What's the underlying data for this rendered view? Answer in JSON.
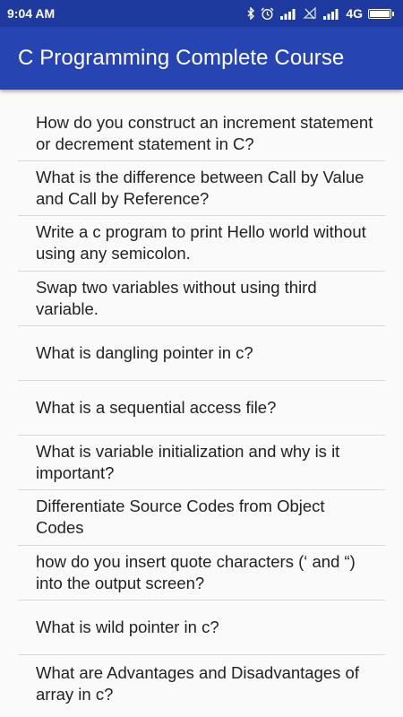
{
  "status_bar": {
    "time": "9:04 AM",
    "network": "4G",
    "icons": [
      "bluetooth-icon",
      "alarm-icon",
      "signal-icon",
      "no-signal-icon",
      "signal-icon",
      "battery-icon"
    ]
  },
  "app_bar": {
    "title": "C Programming Complete Course",
    "background": "#2744b3"
  },
  "questions": [
    "How do you construct an increment statement or decrement statement in C?",
    "What is the difference between Call by Value and Call by Reference?",
    "Write a c program to print Hello world without using any semicolon.",
    "Swap two variables without using third variable.",
    "What is dangling pointer in c?",
    "What is a sequential access file?",
    "What is variable initialization and why is it important?",
    "Differentiate Source Codes from Object Codes",
    "how do you insert quote characters (‘ and “) into the output screen?",
    "What is wild pointer in c?",
    "What are Advantages and Disadvantages of array in c?"
  ]
}
